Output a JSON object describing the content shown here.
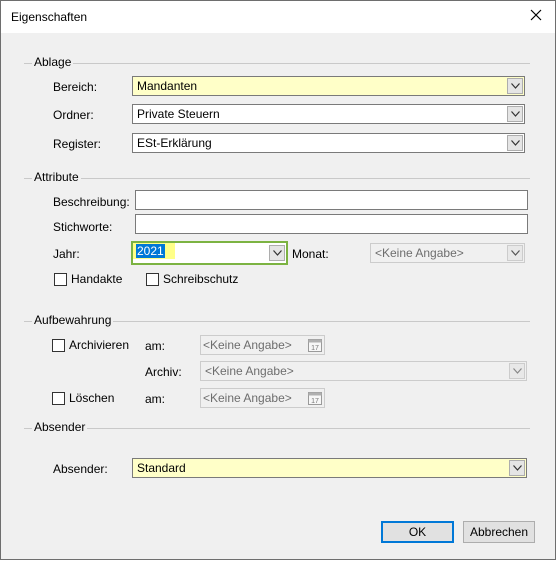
{
  "window": {
    "title": "Eigenschaften"
  },
  "ablage": {
    "group_title": "Ablage",
    "bereich_label": "Bereich:",
    "bereich_value": "Mandanten",
    "ordner_label": "Ordner:",
    "ordner_value": "Private Steuern",
    "register_label": "Register:",
    "register_value": "ESt-Erklärung"
  },
  "attribute": {
    "group_title": "Attribute",
    "beschreibung_label": "Beschreibung:",
    "beschreibung_value": "",
    "stichworte_label": "Stichworte:",
    "stichworte_value": "",
    "jahr_label": "Jahr:",
    "jahr_value": "2021",
    "monat_label": "Monat:",
    "monat_value": "<Keine Angabe>",
    "handakte_label": "Handakte",
    "handakte_checked": false,
    "schreibschutz_label": "Schreibschutz",
    "schreibschutz_checked": false
  },
  "aufbewahrung": {
    "group_title": "Aufbewahrung",
    "archivieren_label": "Archivieren",
    "archivieren_checked": false,
    "archivieren_am_label": "am:",
    "archivieren_am_value": "<Keine Angabe>",
    "archiv_label": "Archiv:",
    "archiv_value": "<Keine Angabe>",
    "loeschen_label": "Löschen",
    "loeschen_checked": false,
    "loeschen_am_label": "am:",
    "loeschen_am_value": "<Keine Angabe>",
    "calendar_day": "17"
  },
  "absender": {
    "group_title": "Absender",
    "absender_label": "Absender:",
    "absender_value": "Standard"
  },
  "buttons": {
    "ok_label": "OK",
    "cancel_label": "Abbrechen"
  },
  "colors": {
    "field_highlight": "#ffffc8",
    "focus_border": "#7cb342",
    "selection": "#0078d7"
  },
  "icons": {
    "close": "close-icon",
    "dropdown": "chevron-down-icon",
    "calendar": "calendar-icon"
  }
}
